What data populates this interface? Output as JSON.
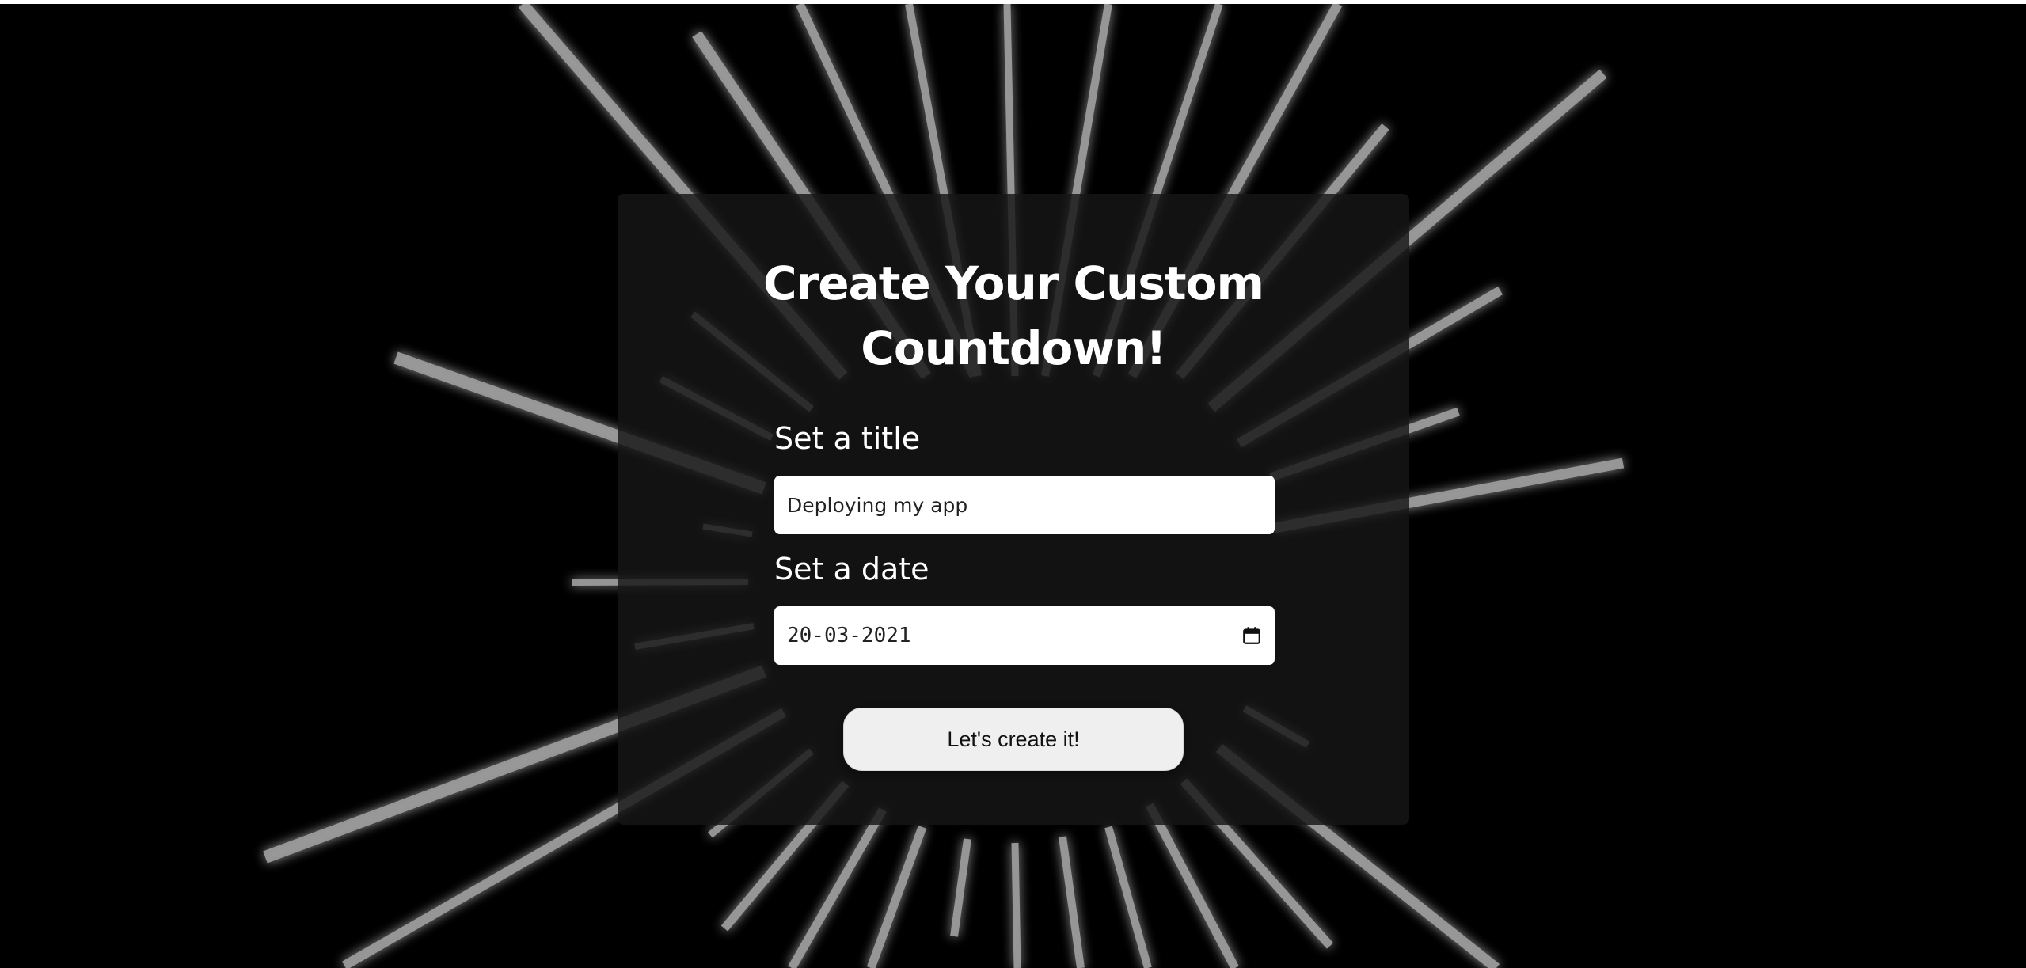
{
  "page": {
    "heading": "Create Your Custom Countdown!",
    "title_label": "Set a title",
    "title_value": "Deploying my app",
    "date_label": "Set a date",
    "date_value": "20-03-2021",
    "submit_label": "Let's create it!"
  },
  "icons": {
    "date_picker": "calendar-icon"
  },
  "colors": {
    "background": "#000000",
    "ray": "#9a9a9a",
    "ray_glow": "#a8a8ff",
    "card": "#161616",
    "text": "#ffffff"
  }
}
